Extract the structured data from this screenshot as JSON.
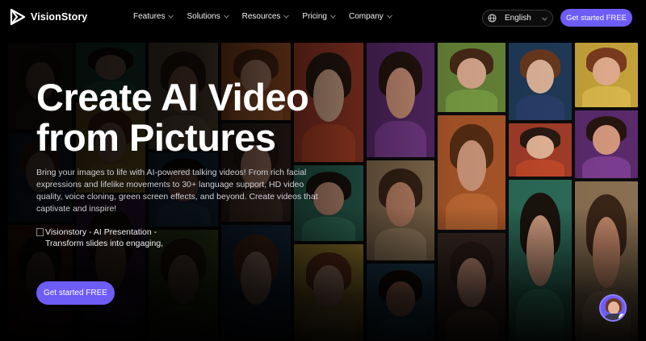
{
  "brand": {
    "name": "VisionStory"
  },
  "nav": {
    "items": [
      {
        "label": "Features"
      },
      {
        "label": "Solutions"
      },
      {
        "label": "Resources"
      },
      {
        "label": "Pricing"
      },
      {
        "label": "Company"
      }
    ],
    "language": "English",
    "cta_label": "Get started FREE"
  },
  "hero": {
    "title_line1": "Create AI Video",
    "title_line2": "from Pictures",
    "description": "Bring your images to life with AI-powered talking videos! From rich facial expressions and lifelike movements to 30+ language support, HD video quality, voice cloning, green screen effects, and beyond. Create videos that captivate and inspire!",
    "image_alt": "Visionstory - AI Presentation - Transform slides into engaging,",
    "cta_label": "Get started FREE"
  },
  "colors": {
    "accent": "#6d5cf6",
    "background": "#000000",
    "muted_text": "#cfcfd4"
  },
  "icons": {
    "logo": "play-triangle-logo-icon",
    "chevron": "chevron-down-icon",
    "language": "globe-icon",
    "chat": "support-avatar-icon"
  }
}
